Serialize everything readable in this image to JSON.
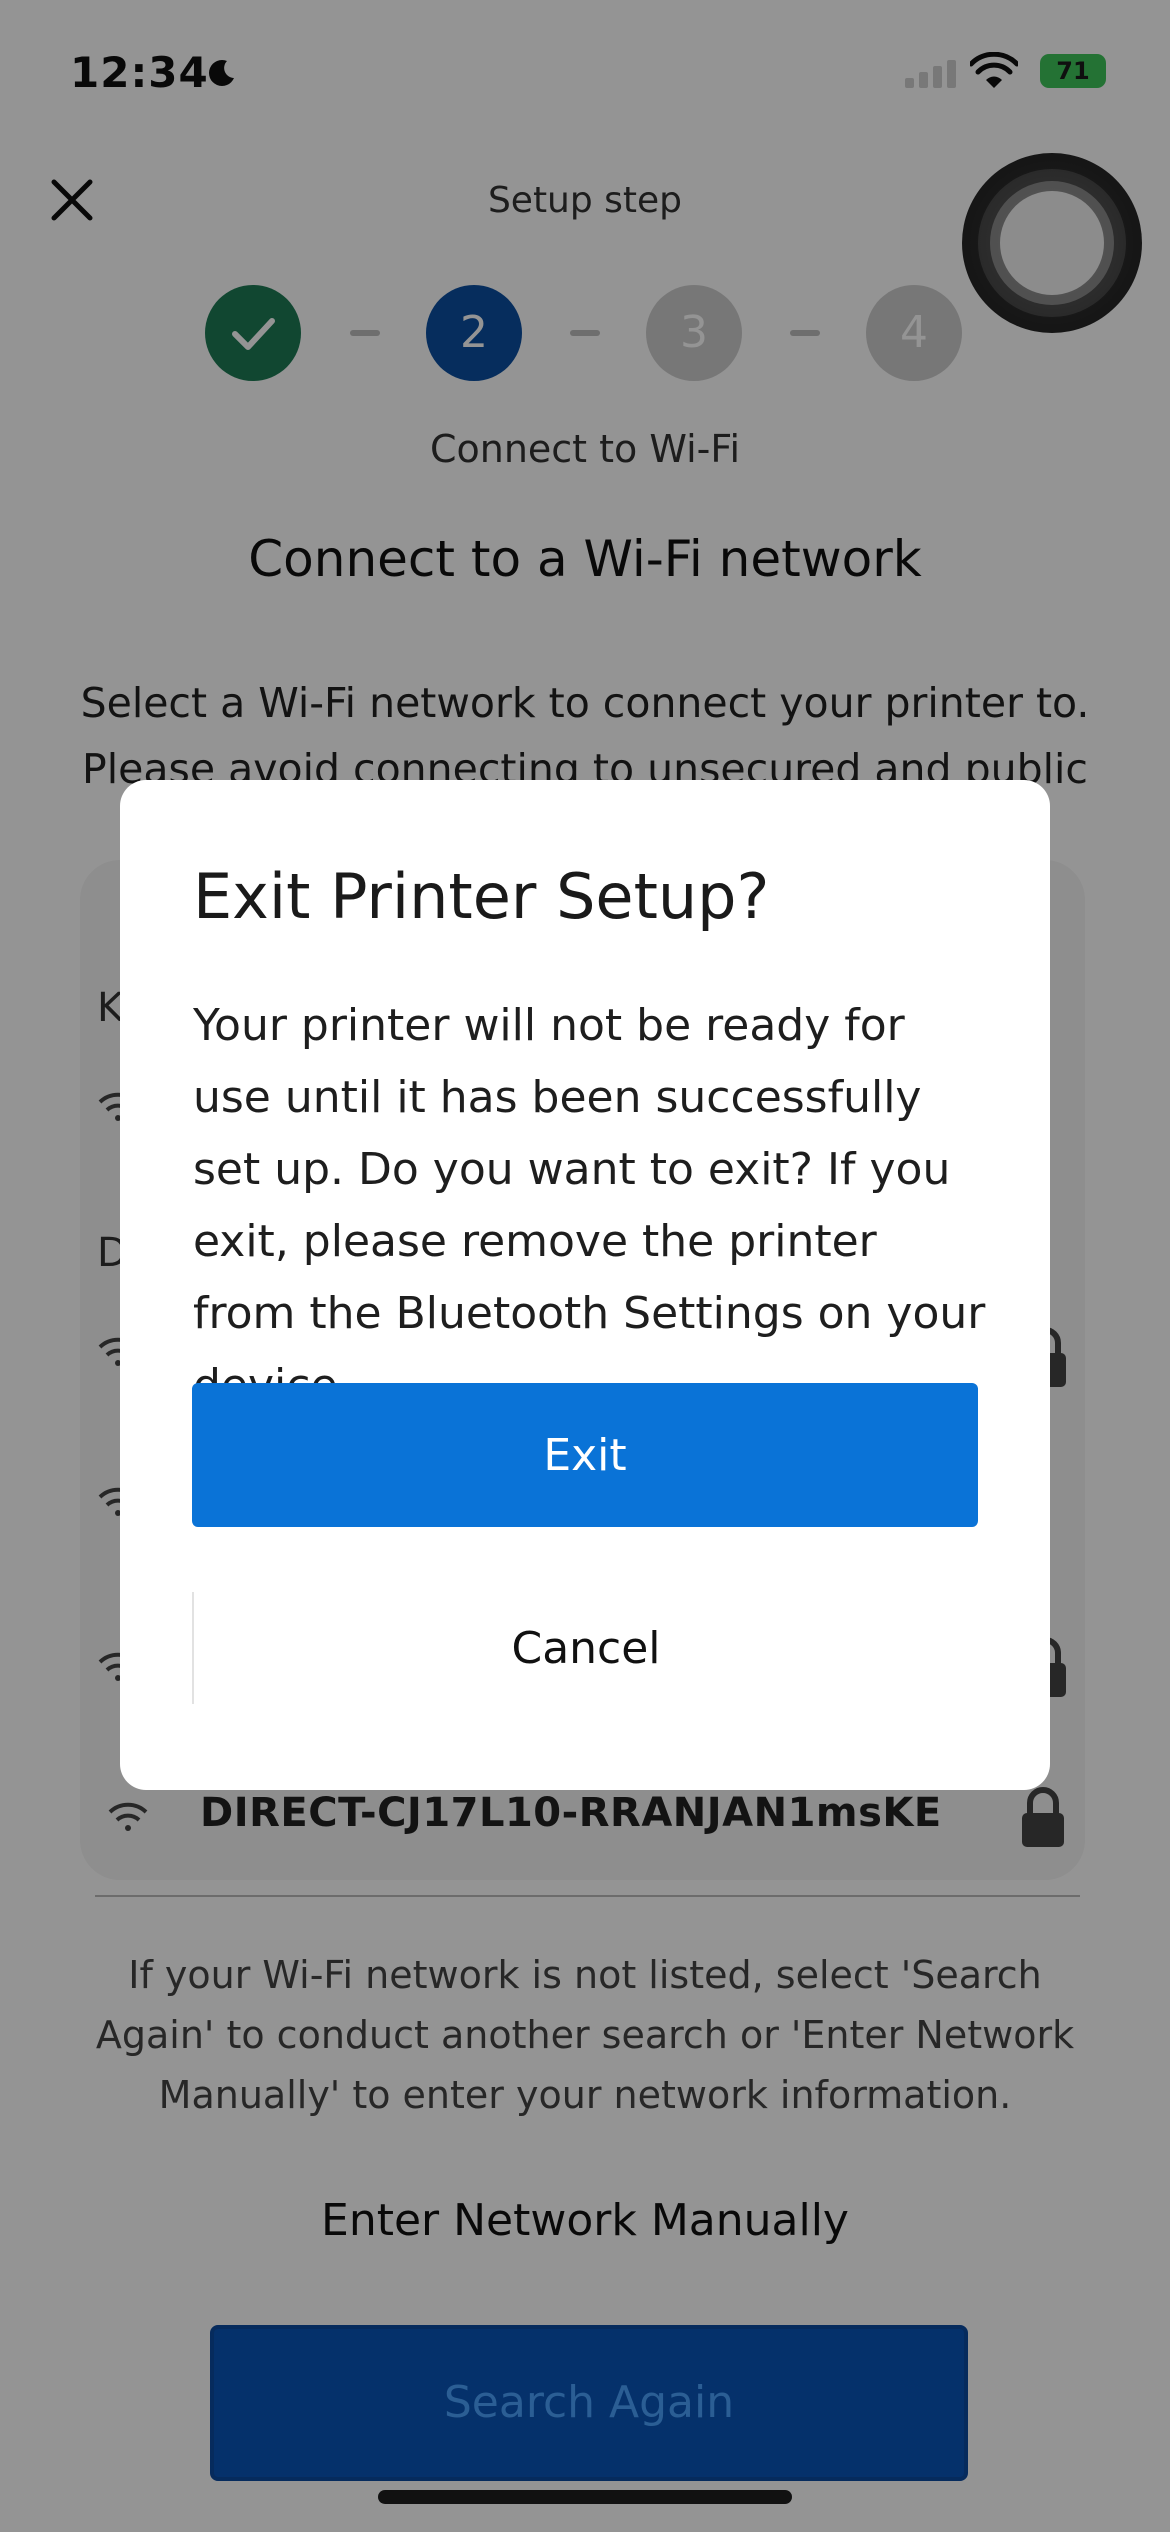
{
  "status_bar": {
    "time": "12:34",
    "battery": "71"
  },
  "header": {
    "title": "Setup step",
    "steps": [
      {
        "label": "✓",
        "state": "done"
      },
      {
        "label": "2",
        "state": "current"
      },
      {
        "label": "3",
        "state": "upcoming"
      },
      {
        "label": "4",
        "state": "upcoming"
      }
    ],
    "step_caption": "Connect to Wi-Fi"
  },
  "main": {
    "title": "Connect to a Wi-Fi network",
    "description": "Select a Wi-Fi network to connect your printer to. Please avoid connecting to unsecured and public",
    "networks": {
      "partial_labels": [
        "K",
        "D"
      ],
      "last_visible": "DIRECT-CJ17L10-RRANJAN1msKE"
    },
    "not_listed_text": "If your Wi-Fi network is not listed, select 'Search Again' to conduct another search or 'Enter Network Manually' to enter your network information.",
    "enter_manual_label": "Enter Network Manually",
    "search_again_label": "Search Again"
  },
  "dialog": {
    "title": "Exit Printer Setup?",
    "body": "Your printer will not be ready for use until it has been successfully set up. Do you want to exit? If you exit, please remove the printer from the Bluetooth Settings on your device.",
    "exit_label": "Exit",
    "cancel_label": "Cancel"
  },
  "colors": {
    "primary": "#0a73d7",
    "step_done": "#1e7a55",
    "step_current": "#0b4fa0"
  }
}
